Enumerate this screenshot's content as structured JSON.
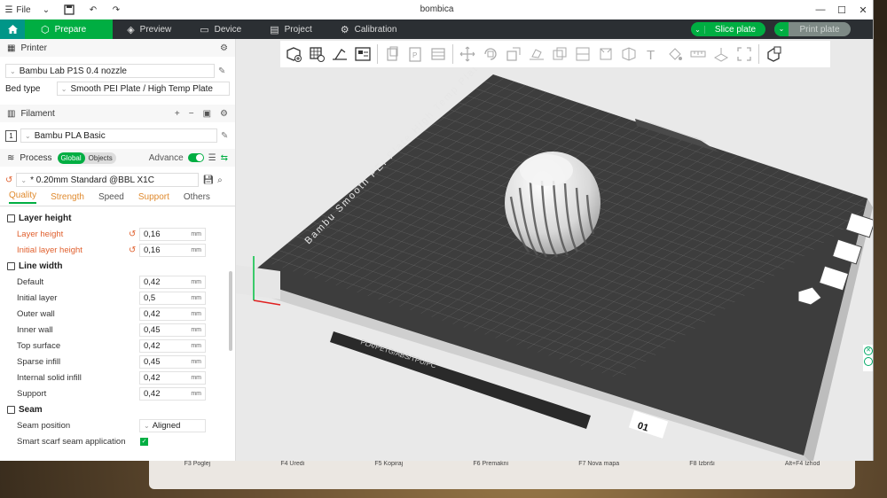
{
  "window": {
    "title": "bombica",
    "file_menu": "File",
    "controls": [
      "—",
      "☐",
      "✕"
    ]
  },
  "tabs": [
    {
      "label": "Prepare",
      "icon": "cube-icon"
    },
    {
      "label": "Preview",
      "icon": "layers-icon"
    },
    {
      "label": "Device",
      "icon": "monitor-icon"
    },
    {
      "label": "Project",
      "icon": "document-icon"
    },
    {
      "label": "Calibration",
      "icon": "gear-icon"
    }
  ],
  "actions": {
    "slice_label": "Slice plate",
    "print_label": "Print plate"
  },
  "printer": {
    "header": "Printer",
    "name": "Bambu Lab P1S 0.4 nozzle",
    "bed_type_label": "Bed type",
    "bed_type": "Smooth PEI Plate / High Temp Plate"
  },
  "filament": {
    "header": "Filament",
    "slot": "1",
    "name": "Bambu PLA Basic"
  },
  "process": {
    "header": "Process",
    "seg_global": "Global",
    "seg_objects": "Objects",
    "advance_label": "Advance",
    "preset": "* 0.20mm Standard @BBL X1C",
    "tabs": [
      "Quality",
      "Strength",
      "Speed",
      "Support",
      "Others"
    ]
  },
  "groups": {
    "layer_height": "Layer height",
    "line_width": "Line width",
    "seam": "Seam"
  },
  "params": {
    "layer_height": {
      "label": "Layer height",
      "value": "0,16",
      "unit": "mm"
    },
    "initial_layer_height": {
      "label": "Initial layer height",
      "value": "0,16",
      "unit": "mm"
    },
    "default": {
      "label": "Default",
      "value": "0,42",
      "unit": "mm"
    },
    "initial_layer": {
      "label": "Initial layer",
      "value": "0,5",
      "unit": "mm"
    },
    "outer_wall": {
      "label": "Outer wall",
      "value": "0,42",
      "unit": "mm"
    },
    "inner_wall": {
      "label": "Inner wall",
      "value": "0,45",
      "unit": "mm"
    },
    "top_surface": {
      "label": "Top surface",
      "value": "0,42",
      "unit": "mm"
    },
    "sparse_infill": {
      "label": "Sparse infill",
      "value": "0,45",
      "unit": "mm"
    },
    "internal_solid_infill": {
      "label": "Internal solid infill",
      "value": "0,42",
      "unit": "mm"
    },
    "support": {
      "label": "Support",
      "value": "0,42",
      "unit": "mm"
    },
    "seam_position": {
      "label": "Seam position",
      "value": "Aligned"
    },
    "smart_scarf": {
      "label": "Smart scarf seam application"
    }
  },
  "plate": {
    "top_text": "Bambu Smooth PEI Plate High Temp Plate",
    "bottom_text": "PLA/PETG/ABS/TPU/PC",
    "plate_number": "01"
  },
  "background_window": {
    "fkeys": [
      "F3 Poglej",
      "F4 Uredi",
      "F5 Kopiraj",
      "F6 Premakni",
      "F7 Nova mapa",
      "F8 Izbriši",
      "Alt+F4 Izhod"
    ]
  },
  "colors": {
    "accent": "#00ae42",
    "modified": "#e0602e",
    "dark_bar": "#2b2f33"
  }
}
